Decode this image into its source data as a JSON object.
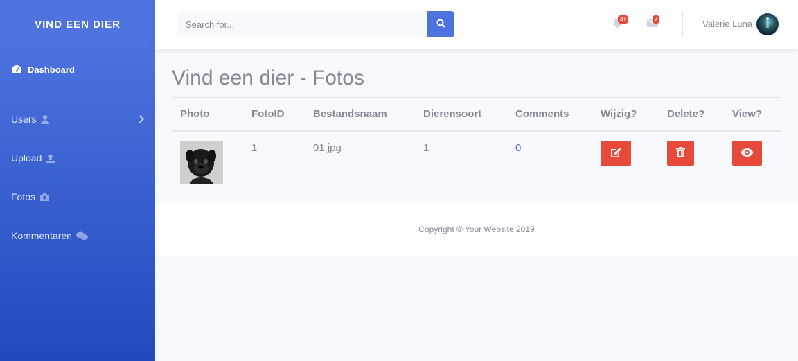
{
  "sidebar": {
    "brand": "VIND EEN DIER",
    "items": [
      {
        "label": "Dashboard",
        "icon": "dashboard-icon"
      },
      {
        "label": "Users",
        "icon": "user-icon"
      },
      {
        "label": "Upload",
        "icon": "upload-icon"
      },
      {
        "label": "Fotos",
        "icon": "camera-icon"
      },
      {
        "label": "Kommentaren",
        "icon": "comments-icon"
      }
    ]
  },
  "topbar": {
    "search_placeholder": "Search for...",
    "alerts_badge": "3+",
    "messages_badge": "7",
    "user_name": "Valerie Luna"
  },
  "main": {
    "title": "Vind een dier - Fotos",
    "table": {
      "headers": [
        "Photo",
        "FotoID",
        "Bestandsnaam",
        "Dierensoort",
        "Comments",
        "Wijzig?",
        "Delete?",
        "View?"
      ],
      "rows": [
        {
          "foto_id": "1",
          "bestandsnaam": "01.jpg",
          "dierensoort": "1",
          "comments": "0"
        }
      ]
    }
  },
  "footer": {
    "copyright": "Copyright © Your Website 2019"
  },
  "colors": {
    "primary": "#4e73df",
    "danger": "#e74a3b",
    "text_muted": "#858796"
  }
}
